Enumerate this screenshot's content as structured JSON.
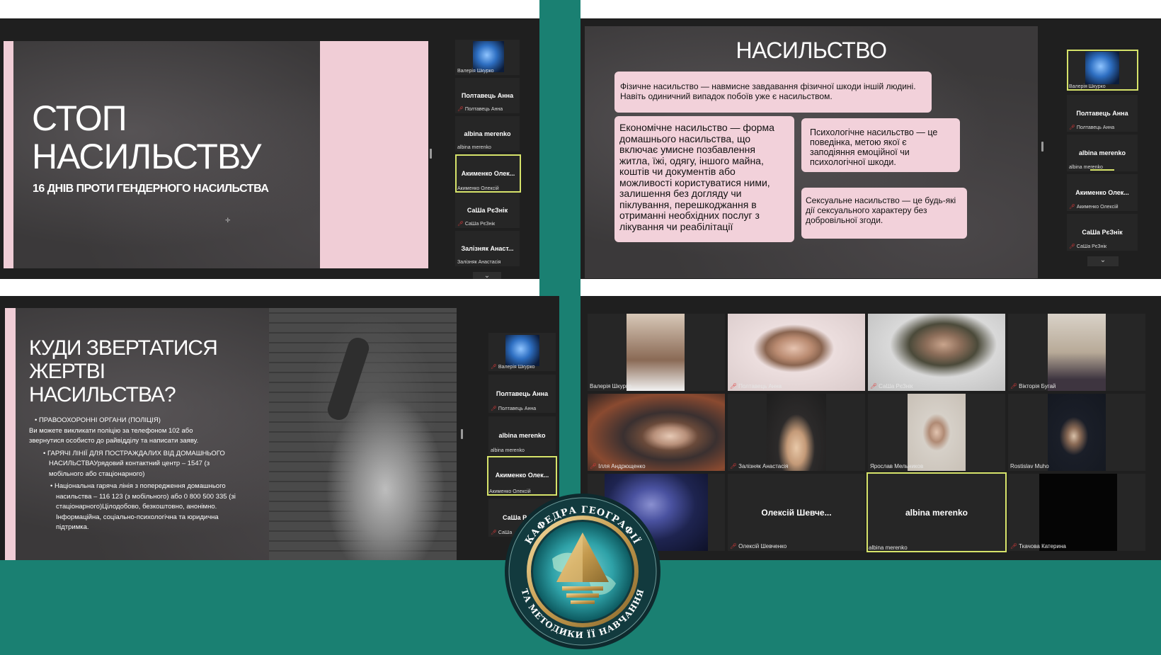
{
  "slide1": {
    "title_line1": "СТОП",
    "title_line2": "НАСИЛЬСТВУ",
    "subtitle": "16 ДНІВ ПРОТИ ГЕНДЕРНОГО НАСИЛЬСТВА"
  },
  "slide2": {
    "title": "НАСИЛЬСТВО",
    "box_physical": "Фізичне насильство — навмисне завдавання фізичної шкоди іншій людині. Навіть одиничний випадок побоїв уже є насильством.",
    "box_economic": "Економічне насильство — форма домашнього насильства, що включає умисне позбавлення житла, їжі, одягу, іншого майна, коштів чи документів або можливості користуватися ними, залишення без догляду чи піклування, перешкоджання в отриманні необхідних послуг з лікування чи реабілітації",
    "box_psych": "Психологічне насильство — це поведінка, метою якої є заподіяння емоційної чи психологічної шкоди.",
    "box_sexual": "Сексуальне насильство — це будь-які дії сексуального характеру без добровільної згоди."
  },
  "slide3": {
    "title_line1": "КУДИ ЗВЕРТАТИСЯ",
    "title_line2": "ЖЕРТВІ",
    "title_line3": "НАСИЛЬСТВА?",
    "bullet1_head": "ПРАВООХОРОННІ ОРГАНИ (ПОЛІЦІЯ)",
    "bullet1_text_a": "Ви можете викликати поліцію за телефоном 102 або",
    "bullet1_text_b": "звернутися особисто до райвідділу та написати заяву.",
    "bullet2_a": "ГАРЯЧІ ЛІНІЇ ДЛЯ ПОСТРАЖДАЛИХ ВІД ДОМАШНЬОГО",
    "bullet2_b": "НАСИЛЬСТВАУрядовий контактний центр – 1547 (з",
    "bullet2_c": "мобільного або стаціонарного)",
    "bullet3_a": "Національна гаряча лінія з попередження домашнього",
    "bullet3_b": "насильства – 116 123 (з мобільного) або 0 800 500 335 (зі",
    "bullet3_c": "стаціонарного)Цілодобово, безкоштовно, анонімно.",
    "bullet3_d": "Інформаційна, соціально-психологічна та юридична",
    "bullet3_e": "підтримка."
  },
  "participants": {
    "valeriia": "Валерія Шкурко",
    "poltavets": "Полтавець Анна",
    "albina": "albina merenko",
    "akymenko_short": "Акименко Олек...",
    "akymenko": "Акименко Олексій",
    "sasha_bold": "СаШа РєЗнік",
    "sasha": "СаШа РєЗнік",
    "zalizniak_short": "Залізняк Анаст...",
    "zalizniak": "Залізняк Анастасія",
    "sasha_short": "СаШа Р",
    "sasha_sub_short": "СаШа",
    "viktoriia": "Вікторія Бугай",
    "illia": "Ілля Андрющенко",
    "yaroslav": "Ярослав Мельников",
    "rostislav": "Rostislav Muho",
    "oleksii_short": "Олексій Шевче...",
    "oleksii": "Олексій Шевченко",
    "tkachova": "Ткачова Катерина"
  },
  "logo": {
    "top_text": "КАФЕДРА ГЕОГРАФІЇ",
    "bottom_text": "ТА МЕТОДИКИ ЇЇ НАВЧАННЯ"
  },
  "icons": {
    "muted_mic": "mic-off-icon",
    "chevron": "chevron-down-icon"
  },
  "colors": {
    "teal": "#1a8072",
    "active_border": "#d6e36a",
    "pink": "#f0cdd6"
  }
}
